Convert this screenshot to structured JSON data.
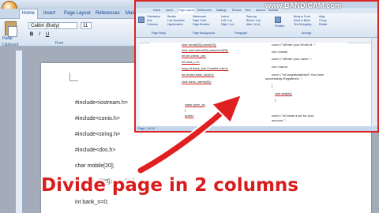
{
  "word": {
    "tabs": [
      "Home",
      "Insert",
      "Page Layout",
      "References",
      "Mailin"
    ],
    "active_tab": "Home",
    "paste_label": "Paste",
    "clipboard_label": "Clipboard",
    "font_name": "Calibri (Body)",
    "font_size": "11",
    "font_group_label": "Font",
    "format_buttons": [
      "B",
      "I",
      "U"
    ]
  },
  "document": {
    "lines": [
      "#include<iostream.h>",
      "#include<conio.h>",
      "#include<string.h>",
      "#include<dos.h>",
      "char mobile[20];",
      "char email[20],name[20];",
      "int bank_n=0;"
    ]
  },
  "inset": {
    "watermark": "www.BANDICAM.com",
    "tabs": [
      "Home",
      "Insert",
      "Page Layout",
      "References",
      "Mailings",
      "Review",
      "View",
      "Add-Ins",
      "Acrobat"
    ],
    "ribbon_items": [
      "Orientation",
      "Size",
      "Columns",
      "Breaks",
      "Line Numbers",
      "Hyphenation",
      "Watermark",
      "Page Color",
      "Page Borders",
      "Indent",
      "Left: 0 pt",
      "Right: 0 pt",
      "Spacing",
      "Before: 0 pt",
      "After: 10 pt",
      "Position",
      "Bring to Front",
      "Send to Back",
      "Text Wrapping",
      "Align",
      "Group",
      "Rotate"
    ],
    "group_labels": [
      "Page Setup",
      "Page Background",
      "Paragraph",
      "Arrange"
    ],
    "left_column": [
      "char email[20],name[20];",
      "char username[20],password[20];",
      "int pin,check_pin;",
      "int bank_l=0;",
      "long int bank_bal=0,wallet_bal=0;",
      "int choice,date_total=0;",
      "char bank_name[40];",
      "class open_ac",
      "{",
      "public:"
    ],
    "right_column": [
      "cout<<\"\\nEnter your Email Id :\";",
      "cin>>email;",
      "cout<<\"\\nEnter your name :\";",
      "cin>>name;",
      "cout<<\"\\nCongratulations!!! You have",
      "successfully Registered..\";",
      "}",
      "void setpin()",
      "{",
      "cout<<\"\\nCreate a pin for your",
      "account :\";"
    ],
    "status": "Page: 1 of 16"
  },
  "caption": "Divide page in 2 columns",
  "colors": {
    "caption": "#d91d1d",
    "arrow": "#e02020",
    "inset_border": "#d22"
  }
}
